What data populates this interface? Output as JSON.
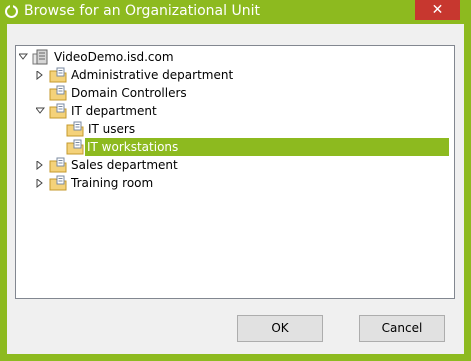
{
  "window": {
    "title": "Browse for an Organizational Unit",
    "close_glyph": "✕",
    "accent": "#8dba1f",
    "close_color": "#c7372f"
  },
  "tree": {
    "root": {
      "label": "VideoDemo.isd.com",
      "icon": "domain-icon",
      "expanded": true
    },
    "items": [
      {
        "label": "Administrative department",
        "icon": "ou-folder-icon",
        "expander": "collapsed"
      },
      {
        "label": "Domain Controllers",
        "icon": "ou-folder-icon",
        "expander": "none"
      },
      {
        "label": "IT department",
        "icon": "ou-folder-icon",
        "expander": "expanded",
        "children": [
          {
            "label": "IT users",
            "icon": "ou-folder-icon"
          },
          {
            "label": "IT workstations",
            "icon": "ou-folder-icon",
            "selected": true
          }
        ]
      },
      {
        "label": "Sales department",
        "icon": "ou-folder-icon",
        "expander": "collapsed"
      },
      {
        "label": "Training room",
        "icon": "ou-folder-icon",
        "expander": "collapsed"
      }
    ]
  },
  "buttons": {
    "ok": "OK",
    "cancel": "Cancel"
  }
}
